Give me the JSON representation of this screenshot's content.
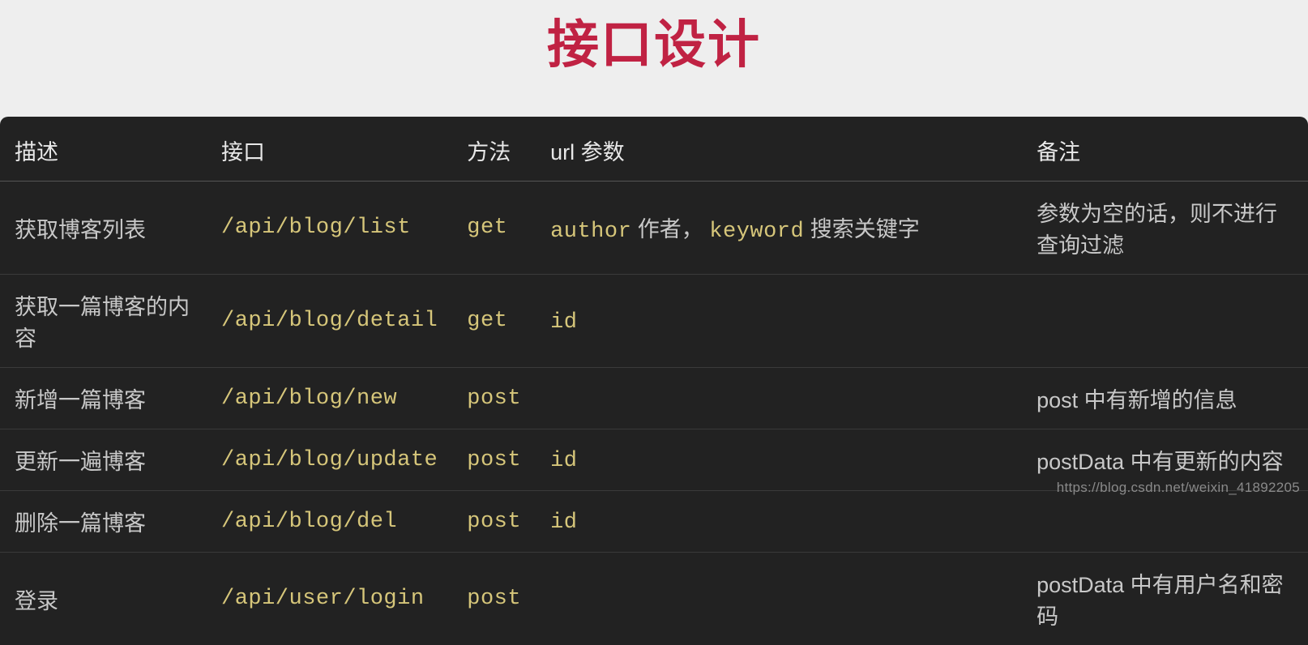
{
  "title": "接口设计",
  "columns": {
    "desc": "描述",
    "api": "接口",
    "method": "方法",
    "params": "url 参数",
    "note": "备注"
  },
  "rows": [
    {
      "desc": "获取博客列表",
      "api": "/api/blog/list",
      "method": "get",
      "params_parts": [
        {
          "t": "mono",
          "v": "author"
        },
        {
          "t": "plain",
          "v": " 作者，  "
        },
        {
          "t": "mono",
          "v": "keyword"
        },
        {
          "t": "plain",
          "v": " 搜索关键字"
        }
      ],
      "note": "参数为空的话，则不进行查询过滤"
    },
    {
      "desc": "获取一篇博客的内容",
      "api": "/api/blog/detail",
      "method": "get",
      "params_parts": [
        {
          "t": "mono",
          "v": "id"
        }
      ],
      "note": ""
    },
    {
      "desc": "新增一篇博客",
      "api": "/api/blog/new",
      "method": "post",
      "params_parts": [],
      "note": "post 中有新增的信息"
    },
    {
      "desc": "更新一遍博客",
      "api": "/api/blog/update",
      "method": "post",
      "params_parts": [
        {
          "t": "mono",
          "v": "id"
        }
      ],
      "note": "postData 中有更新的内容"
    },
    {
      "desc": "删除一篇博客",
      "api": "/api/blog/del",
      "method": "post",
      "params_parts": [
        {
          "t": "mono",
          "v": "id"
        }
      ],
      "note": ""
    },
    {
      "desc": "登录",
      "api": "/api/user/login",
      "method": "post",
      "params_parts": [],
      "note": "postData 中有用户名和密码"
    }
  ],
  "watermark": "https://blog.csdn.net/weixin_41892205"
}
